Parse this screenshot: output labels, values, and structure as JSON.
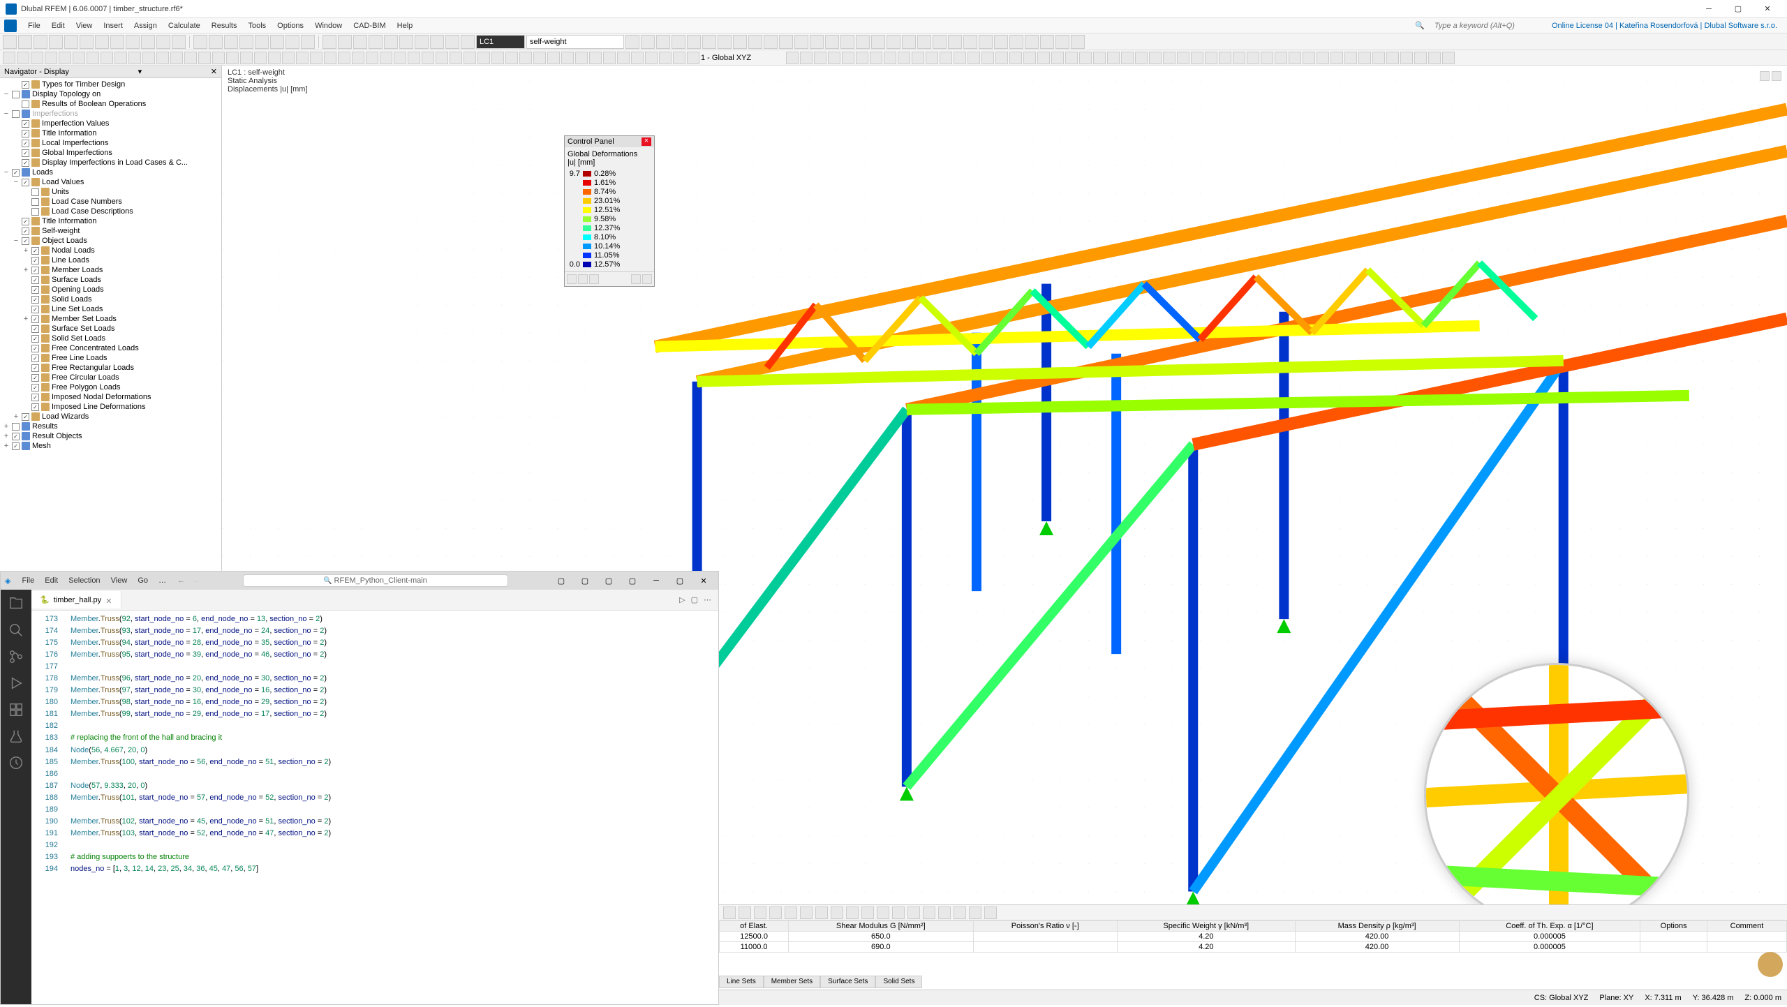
{
  "app": {
    "title": "Dlubal RFEM | 6.06.0007 | timber_structure.rf6*",
    "search_placeholder": "Type a keyword (Alt+Q)",
    "license": "Online License 04 | Kateřina Rosendorfová | Dlubal Software s.r.o."
  },
  "menu": [
    "File",
    "Edit",
    "View",
    "Insert",
    "Assign",
    "Calculate",
    "Results",
    "Tools",
    "Options",
    "Window",
    "CAD-BIM",
    "Help"
  ],
  "toolbar_lc": {
    "label": "LC1",
    "desc": "self-weight"
  },
  "toolbar_cs": "1 - Global XYZ",
  "navigator": {
    "title": "Navigator - Display",
    "items": [
      {
        "lvl": 1,
        "exp": "",
        "chk": true,
        "label": "Types for Timber Design"
      },
      {
        "lvl": 0,
        "exp": "−",
        "chk": false,
        "label": "Display Topology on",
        "ico": "blue"
      },
      {
        "lvl": 1,
        "exp": "",
        "chk": false,
        "label": "Results of Boolean Operations"
      },
      {
        "lvl": 0,
        "exp": "−",
        "chk": false,
        "label": "Imperfections",
        "ico": "blue",
        "dim": true
      },
      {
        "lvl": 1,
        "exp": "",
        "chk": true,
        "label": "Imperfection Values"
      },
      {
        "lvl": 1,
        "exp": "",
        "chk": true,
        "label": "Title Information"
      },
      {
        "lvl": 1,
        "exp": "",
        "chk": true,
        "label": "Local Imperfections"
      },
      {
        "lvl": 1,
        "exp": "",
        "chk": true,
        "label": "Global Imperfections"
      },
      {
        "lvl": 1,
        "exp": "",
        "chk": true,
        "label": "Display Imperfections in Load Cases & C..."
      },
      {
        "lvl": 0,
        "exp": "−",
        "chk": true,
        "label": "Loads",
        "ico": "blue"
      },
      {
        "lvl": 1,
        "exp": "−",
        "chk": true,
        "label": "Load Values"
      },
      {
        "lvl": 2,
        "exp": "",
        "chk": false,
        "label": "Units"
      },
      {
        "lvl": 2,
        "exp": "",
        "chk": false,
        "label": "Load Case Numbers"
      },
      {
        "lvl": 2,
        "exp": "",
        "chk": false,
        "label": "Load Case Descriptions"
      },
      {
        "lvl": 1,
        "exp": "",
        "chk": true,
        "label": "Title Information"
      },
      {
        "lvl": 1,
        "exp": "",
        "chk": true,
        "label": "Self-weight"
      },
      {
        "lvl": 1,
        "exp": "−",
        "chk": true,
        "label": "Object Loads"
      },
      {
        "lvl": 2,
        "exp": "+",
        "chk": true,
        "label": "Nodal Loads"
      },
      {
        "lvl": 2,
        "exp": "",
        "chk": true,
        "label": "Line Loads"
      },
      {
        "lvl": 2,
        "exp": "+",
        "chk": true,
        "label": "Member Loads"
      },
      {
        "lvl": 2,
        "exp": "",
        "chk": true,
        "label": "Surface Loads"
      },
      {
        "lvl": 2,
        "exp": "",
        "chk": true,
        "label": "Opening Loads"
      },
      {
        "lvl": 2,
        "exp": "",
        "chk": true,
        "label": "Solid Loads"
      },
      {
        "lvl": 2,
        "exp": "",
        "chk": true,
        "label": "Line Set Loads"
      },
      {
        "lvl": 2,
        "exp": "+",
        "chk": true,
        "label": "Member Set Loads"
      },
      {
        "lvl": 2,
        "exp": "",
        "chk": true,
        "label": "Surface Set Loads"
      },
      {
        "lvl": 2,
        "exp": "",
        "chk": true,
        "label": "Solid Set Loads"
      },
      {
        "lvl": 2,
        "exp": "",
        "chk": true,
        "label": "Free Concentrated Loads"
      },
      {
        "lvl": 2,
        "exp": "",
        "chk": true,
        "label": "Free Line Loads"
      },
      {
        "lvl": 2,
        "exp": "",
        "chk": true,
        "label": "Free Rectangular Loads"
      },
      {
        "lvl": 2,
        "exp": "",
        "chk": true,
        "label": "Free Circular Loads"
      },
      {
        "lvl": 2,
        "exp": "",
        "chk": true,
        "label": "Free Polygon Loads"
      },
      {
        "lvl": 2,
        "exp": "",
        "chk": true,
        "label": "Imposed Nodal Deformations"
      },
      {
        "lvl": 2,
        "exp": "",
        "chk": true,
        "label": "Imposed Line Deformations"
      },
      {
        "lvl": 1,
        "exp": "+",
        "chk": true,
        "label": "Load Wizards"
      },
      {
        "lvl": 0,
        "exp": "+",
        "chk": false,
        "label": "Results",
        "ico": "blue"
      },
      {
        "lvl": 0,
        "exp": "+",
        "chk": true,
        "label": "Result Objects",
        "ico": "blue"
      },
      {
        "lvl": 0,
        "exp": "+",
        "chk": true,
        "label": "Mesh",
        "ico": "blue"
      }
    ]
  },
  "view": {
    "line1": "LC1 : self-weight",
    "line2": "Static Analysis",
    "line3": "Displacements |u| [mm]"
  },
  "control_panel": {
    "title": "Control Panel",
    "subtitle": "Global Deformations\n|u| [mm]",
    "legend": [
      {
        "c": "#b30000",
        "v": "0.28%"
      },
      {
        "c": "#e60000",
        "v": "1.61%"
      },
      {
        "c": "#ff6600",
        "v": "8.74%"
      },
      {
        "c": "#ffcc00",
        "v": "23.01%"
      },
      {
        "c": "#ffff00",
        "v": "12.51%"
      },
      {
        "c": "#99ff33",
        "v": "9.58%"
      },
      {
        "c": "#33ff99",
        "v": "12.37%"
      },
      {
        "c": "#00ffff",
        "v": "8.10%"
      },
      {
        "c": "#0099ff",
        "v": "10.14%"
      },
      {
        "c": "#0033ff",
        "v": "11.05%"
      },
      {
        "c": "#0000b3",
        "v": "12.57%"
      }
    ],
    "scale_top": "9.7",
    "scale_bot": "0.0"
  },
  "vscode": {
    "menu": [
      "File",
      "Edit",
      "Selection",
      "View",
      "Go",
      "…"
    ],
    "search": "RFEM_Python_Client-main",
    "tab": "timber_hall.py",
    "lines": [
      {
        "n": 173,
        "t": "Member.Truss(92, start_node_no = 6, end_node_no = 13, section_no = 2)"
      },
      {
        "n": 174,
        "t": "Member.Truss(93, start_node_no = 17, end_node_no = 24, section_no = 2)"
      },
      {
        "n": 175,
        "t": "Member.Truss(94, start_node_no = 28, end_node_no = 35, section_no = 2)"
      },
      {
        "n": 176,
        "t": "Member.Truss(95, start_node_no = 39, end_node_no = 46, section_no = 2)"
      },
      {
        "n": 177,
        "t": ""
      },
      {
        "n": 178,
        "t": "Member.Truss(96, start_node_no = 20, end_node_no = 30, section_no = 2)"
      },
      {
        "n": 179,
        "t": "Member.Truss(97, start_node_no = 30, end_node_no = 16, section_no = 2)"
      },
      {
        "n": 180,
        "t": "Member.Truss(98, start_node_no = 16, end_node_no = 29, section_no = 2)"
      },
      {
        "n": 181,
        "t": "Member.Truss(99, start_node_no = 29, end_node_no = 17, section_no = 2)"
      },
      {
        "n": 182,
        "t": ""
      },
      {
        "n": 183,
        "t": "# replacing the front of the hall and bracing it",
        "cmt": true
      },
      {
        "n": 184,
        "t": "Node(56, 4.667, 20, 0)"
      },
      {
        "n": 185,
        "t": "Member.Truss(100, start_node_no = 56, end_node_no = 51, section_no = 2)"
      },
      {
        "n": 186,
        "t": ""
      },
      {
        "n": 187,
        "t": "Node(57, 9.333, 20, 0)"
      },
      {
        "n": 188,
        "t": "Member.Truss(101, start_node_no = 57, end_node_no = 52, section_no = 2)"
      },
      {
        "n": 189,
        "t": ""
      },
      {
        "n": 190,
        "t": "Member.Truss(102, start_node_no = 45, end_node_no = 51, section_no = 2)"
      },
      {
        "n": 191,
        "t": "Member.Truss(103, start_node_no = 52, end_node_no = 47, section_no = 2)"
      },
      {
        "n": 192,
        "t": ""
      },
      {
        "n": 193,
        "t": "# adding suppoerts to the structure",
        "cmt": true
      },
      {
        "n": 194,
        "t": "nodes_no = [1, 3, 12, 14, 23, 25, 34, 36, 45, 47, 56, 57]"
      }
    ]
  },
  "bottom_table": {
    "headers": [
      "of Elast.",
      "Shear Modulus G [N/mm²]",
      "Poisson's Ratio ν [-]",
      "Specific Weight γ [kN/m³]",
      "Mass Density ρ [kg/m³]",
      "Coeff. of Th. Exp. α [1/°C]",
      "Options",
      "Comment"
    ],
    "rows": [
      [
        "12500.0",
        "650.0",
        "",
        "4.20",
        "420.00",
        "0.000005",
        "",
        ""
      ],
      [
        "11000.0",
        "690.0",
        "",
        "4.20",
        "420.00",
        "0.000005",
        "",
        ""
      ]
    ],
    "tabs": [
      "Line Sets",
      "Member Sets",
      "Surface Sets",
      "Solid Sets"
    ]
  },
  "statusbar": {
    "cs": "CS: Global XYZ",
    "plane": "Plane: XY",
    "x": "X: 7.311 m",
    "y": "Y: 36.428 m",
    "z": "Z: 0.000 m"
  }
}
